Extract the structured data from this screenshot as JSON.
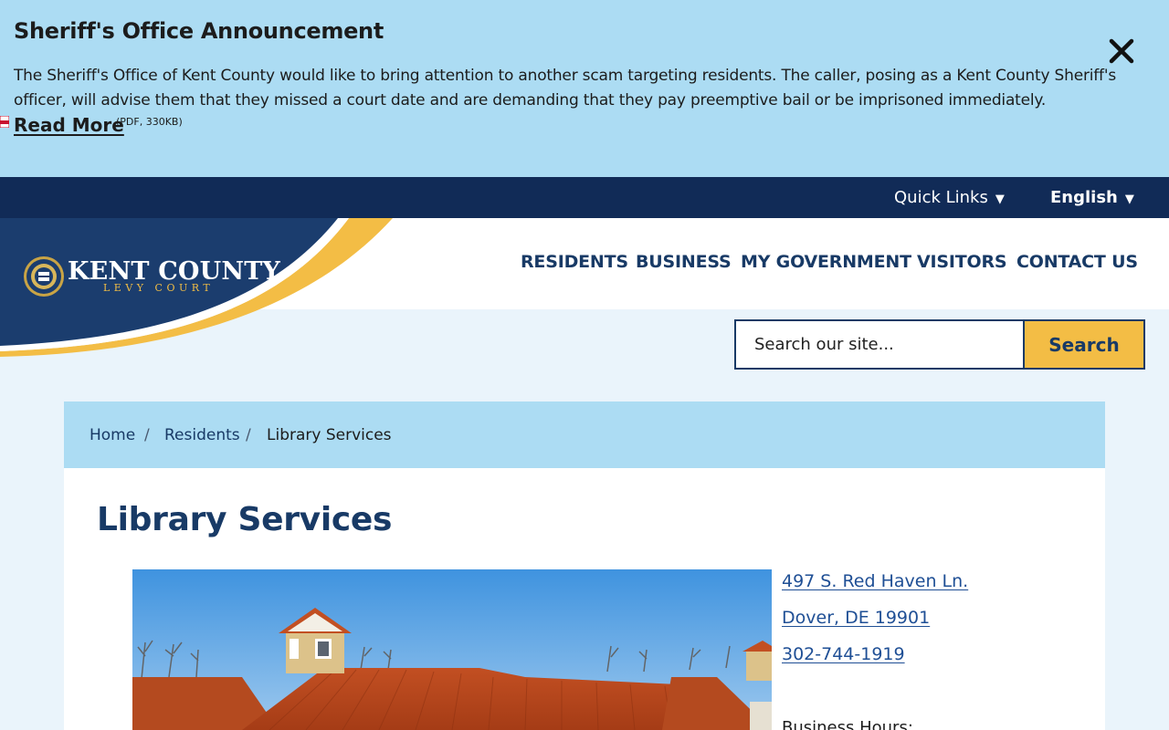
{
  "announcement": {
    "title": "Sheriff's Office Announcement",
    "body": "The Sheriff's Office of Kent County would like to bring attention to another scam targeting residents. The caller, posing as a Kent County Sheriff's officer, will advise them that they missed a court date and are demanding that they pay preemptive bail or be imprisoned immediately.",
    "read_more_label": "Read More",
    "read_more_meta": "(PDF, 330KB)",
    "close_icon": "close-icon",
    "pdf_icon": "pdf-icon"
  },
  "utility_bar": {
    "quick_links_label": "Quick Links",
    "language_label": "English",
    "caret": "▼"
  },
  "brand": {
    "name": "KENT COUNTY",
    "subtitle": "LEVY COURT",
    "seal_icon": "county-seal-icon"
  },
  "nav": {
    "items": [
      {
        "label": "RESIDENTS"
      },
      {
        "label": "BUSINESS"
      },
      {
        "label": "MY GOVERNMENT"
      },
      {
        "label": "VISITORS"
      },
      {
        "label": "CONTACT US"
      }
    ]
  },
  "search": {
    "placeholder": "Search our site...",
    "button_label": "Search"
  },
  "breadcrumb": {
    "items": [
      {
        "label": "Home"
      },
      {
        "label": "Residents"
      },
      {
        "label": "Library Services"
      }
    ],
    "separator": "/"
  },
  "page": {
    "title": "Library Services",
    "address_line1": "497 S. Red Haven Ln.",
    "address_line2": "Dover, DE 19901",
    "phone": "302-744-1919",
    "hours_label": "Business Hours:"
  },
  "colors": {
    "announcement_bg": "#acdcf3",
    "navy": "#112b57",
    "brand_blue": "#183a66",
    "gold": "#f3bd45",
    "link_blue": "#1f4f95",
    "page_bg": "#eaf4fb"
  }
}
